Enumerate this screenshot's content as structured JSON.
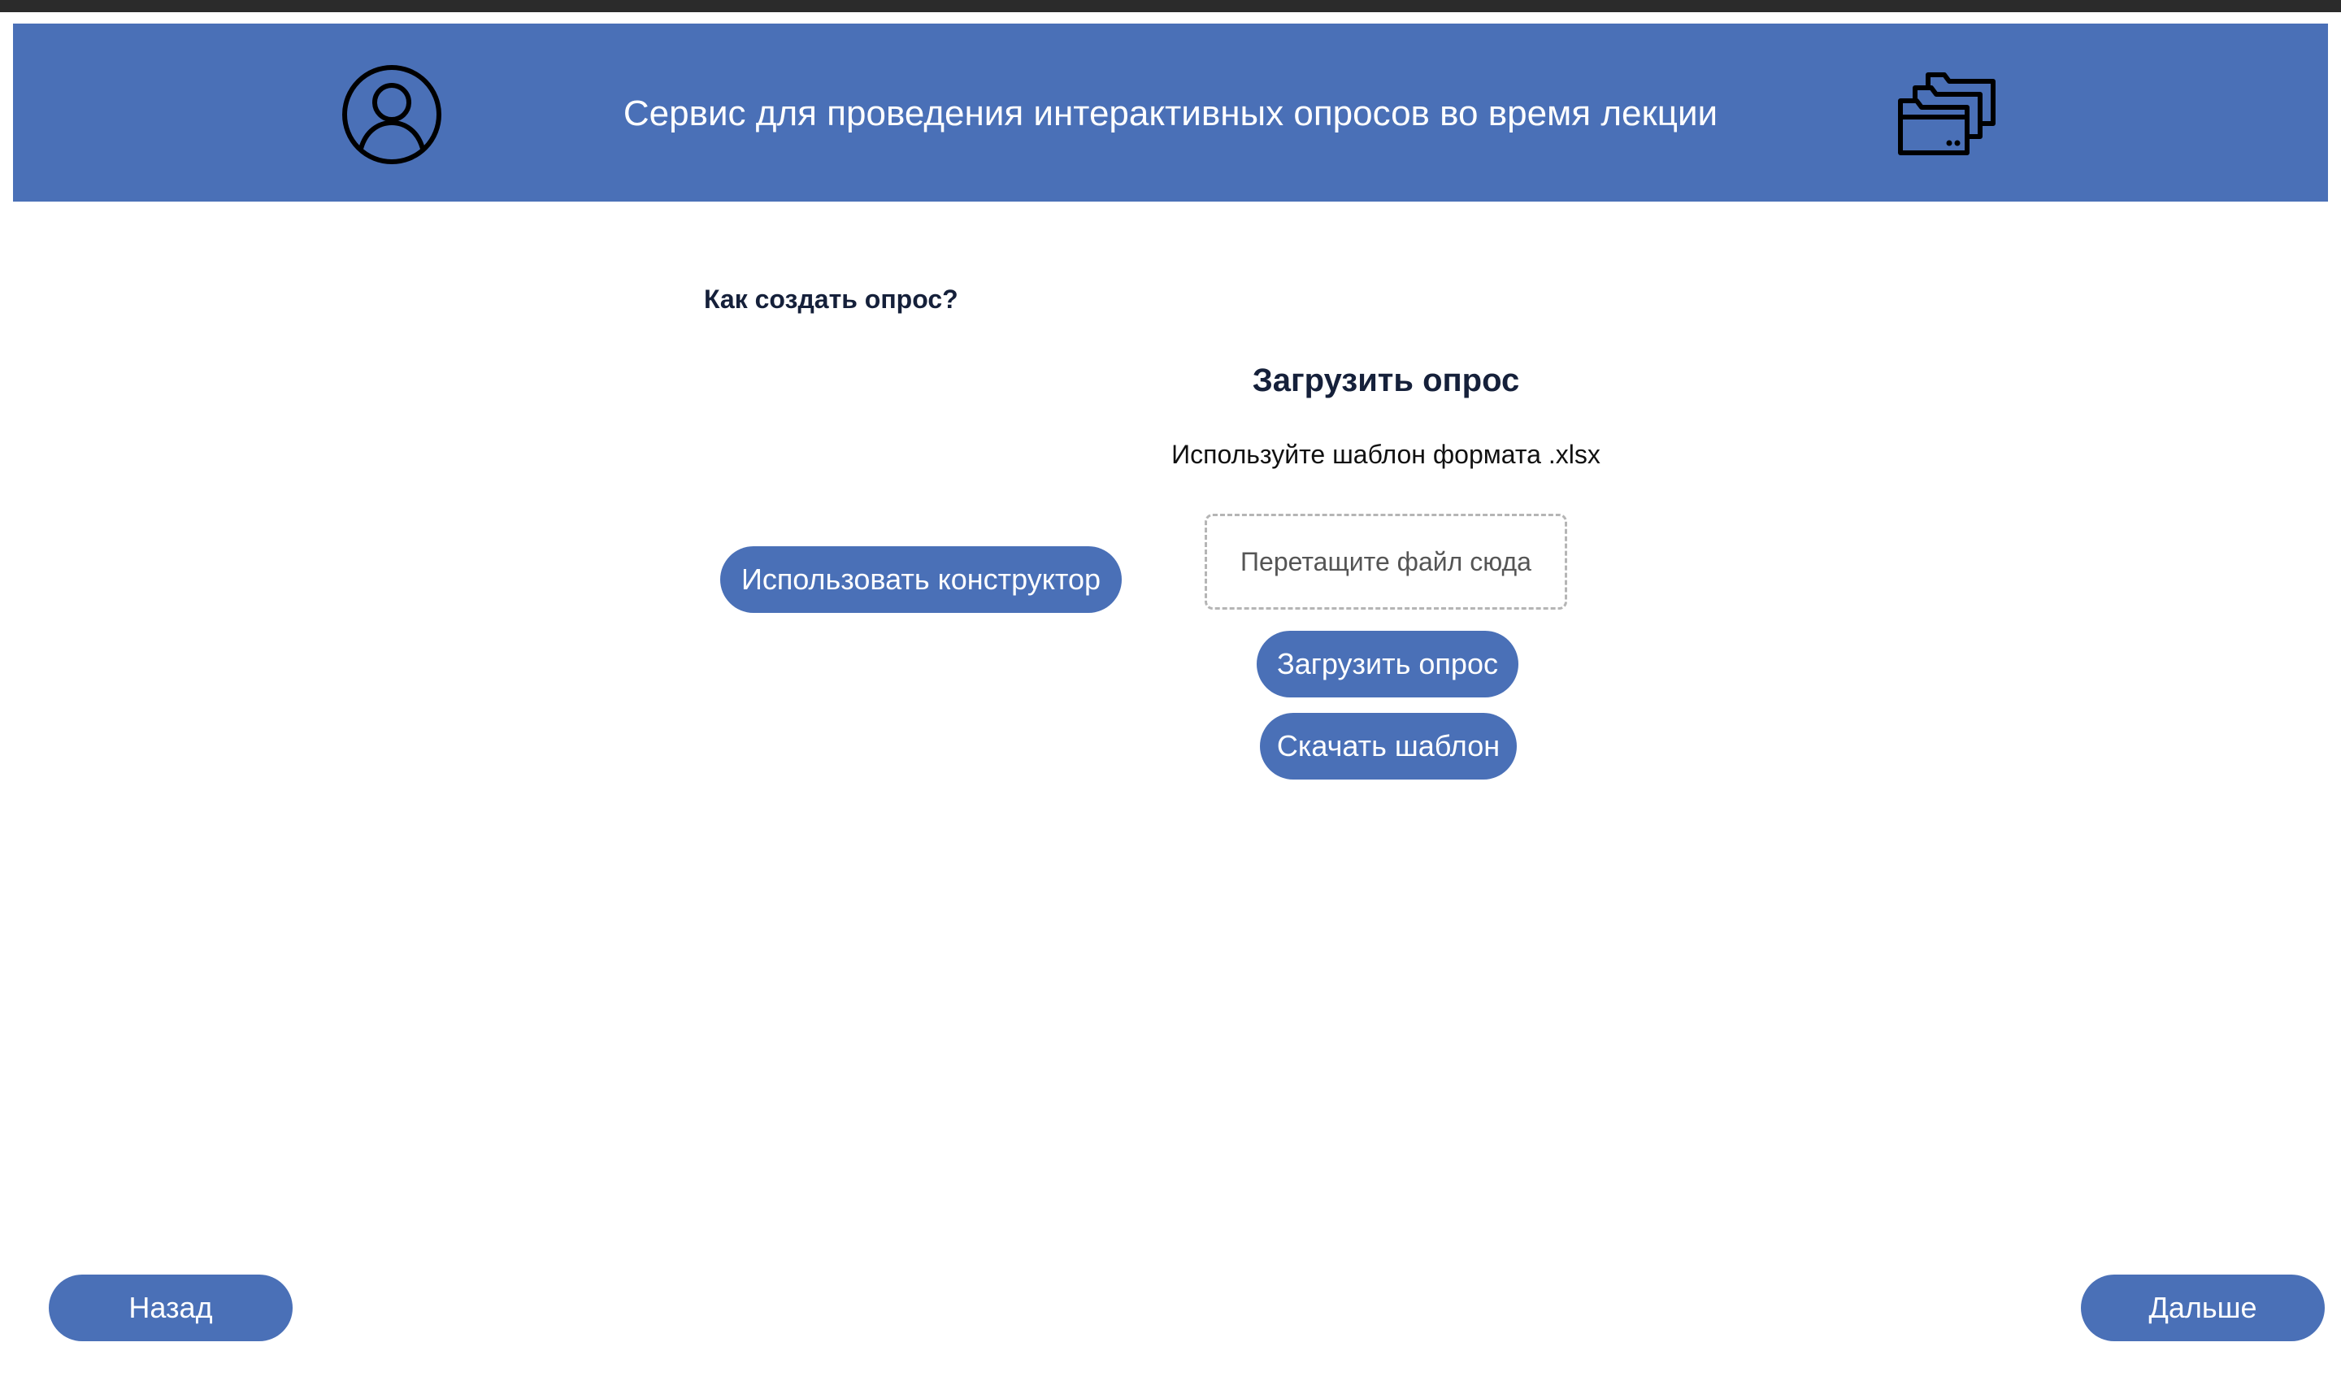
{
  "header": {
    "title": "Сервис для проведения интерактивных опросов во время лекции",
    "profile_icon": "user-circle-icon",
    "folders_icon": "folders-icon"
  },
  "help": {
    "label": "Как создать опрос?"
  },
  "constructor": {
    "button_label": "Использовать конструктор"
  },
  "upload": {
    "title": "Загрузить опрос",
    "hint": "Используйте шаблон формата .xlsx",
    "dropzone_text": "Перетащите файл сюда",
    "upload_button_label": "Загрузить опрос",
    "template_button_label": "Скачать шаблон"
  },
  "navigation": {
    "back_label": "Назад",
    "next_label": "Дальше"
  },
  "colors": {
    "accent": "#4a70b7",
    "header_text": "#ffffff",
    "dropzone_border": "#b5b5b5"
  }
}
